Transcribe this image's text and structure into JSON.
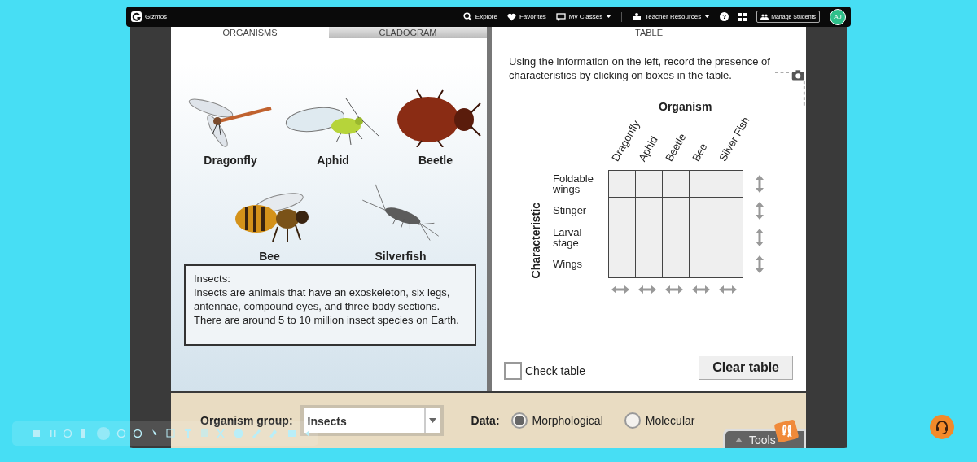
{
  "nav": {
    "logo": "Gizmos",
    "links": [
      {
        "label": "Explore",
        "kind": "search",
        "dropdown": false
      },
      {
        "label": "Favorites",
        "kind": "heart",
        "dropdown": false
      },
      {
        "label": "My Classes",
        "kind": "classes",
        "dropdown": true
      },
      {
        "label": "Teacher Resources",
        "kind": "resources",
        "dropdown": true
      }
    ],
    "help": "?",
    "manage_button": "Manage Students",
    "avatar": "AJ"
  },
  "left_tabs": [
    {
      "label": "ORGANISMS",
      "selected": true
    },
    {
      "label": "CLADOGRAM",
      "selected": false
    }
  ],
  "right_tabs": [
    {
      "label": "TABLE",
      "selected": true
    }
  ],
  "organisms": [
    {
      "name": "Dragonfly",
      "kind": "dragonfly"
    },
    {
      "name": "Aphid",
      "kind": "aphid"
    },
    {
      "name": "Beetle",
      "kind": "beetle"
    },
    {
      "name": "Bee",
      "kind": "bee"
    },
    {
      "name": "Silverfish",
      "kind": "silverfish"
    }
  ],
  "info": {
    "title": "Insects:",
    "text": "Insects are animals that have an exoskeleton, six legs, antennae, compound eyes, and three body sections. There are around 5 to 10 million insect species on Earth."
  },
  "instructions": "Using the information on the left, record the presence of characteristics by clicking on boxes in the table.",
  "table": {
    "title": "Organism",
    "axis_label": "Characteristic",
    "columns": [
      "Dragonfly",
      "Aphid",
      "Beetle",
      "Bee",
      "Silver Fish"
    ],
    "rows": [
      "Foldable wings",
      "Stinger",
      "Larval stage",
      "Wings"
    ]
  },
  "check_table": {
    "label": "Check table",
    "checked": false
  },
  "clear_button": "Clear table",
  "organism_group": {
    "label": "Organism group:",
    "value": "Insects"
  },
  "data": {
    "label": "Data:",
    "options": [
      {
        "label": "Morphological",
        "selected": true
      },
      {
        "label": "Molecular",
        "selected": false
      }
    ]
  },
  "tools": "Tools"
}
